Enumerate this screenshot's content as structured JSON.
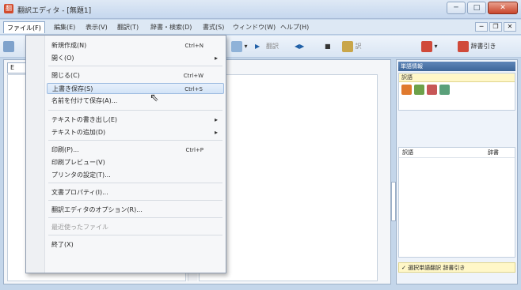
{
  "window": {
    "title": "翻訳エディタ - [無題1]",
    "icon": "app-icon",
    "min": "─",
    "max": "□",
    "close": "✕"
  },
  "menubar": {
    "items": [
      "ファイル(F)",
      "編集(E)",
      "表示(V)",
      "翻訳(T)",
      "辞書・検索(D)",
      "書式(S)",
      "ウィンドウ(W)",
      "ヘルプ(H)"
    ]
  },
  "mdi": {
    "min": "─",
    "restore": "❐",
    "close": "✕"
  },
  "toolbar": {
    "items": [
      "▾",
      "▶",
      "翻訳",
      "◀▶",
      "■",
      "訳",
      "▾",
      "辞書引き"
    ]
  },
  "doc": {
    "tab": "E"
  },
  "file_menu": {
    "items": [
      {
        "label": "新規作成(N)",
        "shortcut": "Ctrl+N",
        "arrow": ""
      },
      {
        "label": "開く(O)",
        "shortcut": "",
        "arrow": "▸"
      },
      {
        "label": "閉じる(C)",
        "shortcut": "Ctrl+W",
        "arrow": ""
      },
      {
        "label": "上書き保存(S)",
        "shortcut": "Ctrl+S",
        "arrow": ""
      },
      {
        "label": "名前を付けて保存(A)...",
        "shortcut": "",
        "arrow": ""
      },
      {
        "label": "テキストの書き出し(E)",
        "shortcut": "",
        "arrow": "▸"
      },
      {
        "label": "テキストの追加(D)",
        "shortcut": "",
        "arrow": "▸"
      },
      {
        "label": "印刷(P)...",
        "shortcut": "Ctrl+P",
        "arrow": ""
      },
      {
        "label": "印刷プレビュー(V)",
        "shortcut": "",
        "arrow": ""
      },
      {
        "label": "プリンタの設定(T)...",
        "shortcut": "",
        "arrow": ""
      },
      {
        "label": "文書プロパティ(I)...",
        "shortcut": "",
        "arrow": ""
      },
      {
        "label": "翻訳エディタのオプション(R)...",
        "shortcut": "",
        "arrow": ""
      },
      {
        "label": "最近使ったファイル",
        "shortcut": "",
        "arrow": ""
      },
      {
        "label": "終了(X)",
        "shortcut": "",
        "arrow": ""
      }
    ]
  },
  "side_panel": {
    "title": "単語情報",
    "sub_header": "訳語",
    "col1": "訳語",
    "col2": "辞書",
    "footer": "✓ 選択単語翻訳 辞書引き"
  },
  "colors": {
    "accent": "#3e6699",
    "highlight": "#d2e3f7",
    "titlebar": "#c5d7ee"
  }
}
